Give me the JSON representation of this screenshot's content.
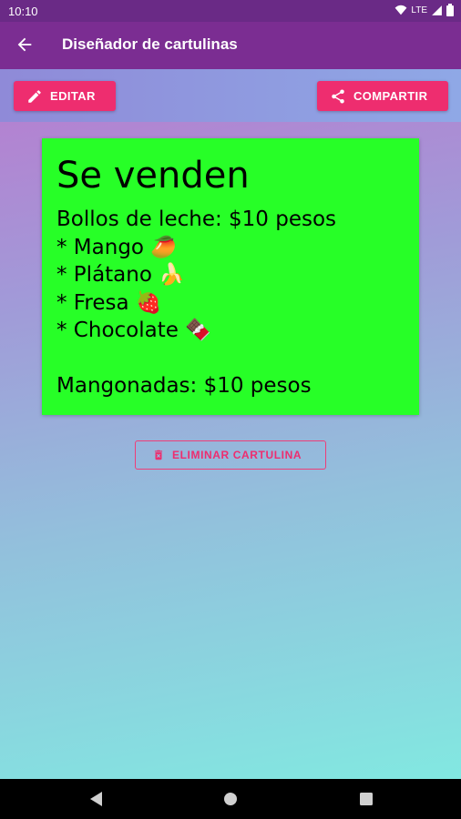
{
  "status_bar": {
    "time": "10:10",
    "network": "LTE"
  },
  "app_bar": {
    "title": "Diseñador de cartulinas"
  },
  "toolbar": {
    "edit_label": "EDITAR",
    "share_label": "COMPARTIR"
  },
  "card": {
    "background": "#27ff27",
    "title": "Se venden",
    "body": "Bollos de leche: $10 pesos\n* Mango 🥭\n* Plátano 🍌\n* Fresa 🍓\n* Chocolate 🍫\n\nMangonadas: $10 pesos"
  },
  "actions": {
    "delete_label": "ELIMINAR CARTULINA"
  },
  "colors": {
    "accent": "#ee2d6f",
    "app_bar": "#7b2d92",
    "status_bar": "#6a2a86"
  },
  "icons": [
    "arrow-back-icon",
    "pencil-icon",
    "share-icon",
    "trash-icon",
    "wifi-icon",
    "signal-icon",
    "battery-icon",
    "nav-back-icon",
    "nav-home-icon",
    "nav-recents-icon"
  ]
}
